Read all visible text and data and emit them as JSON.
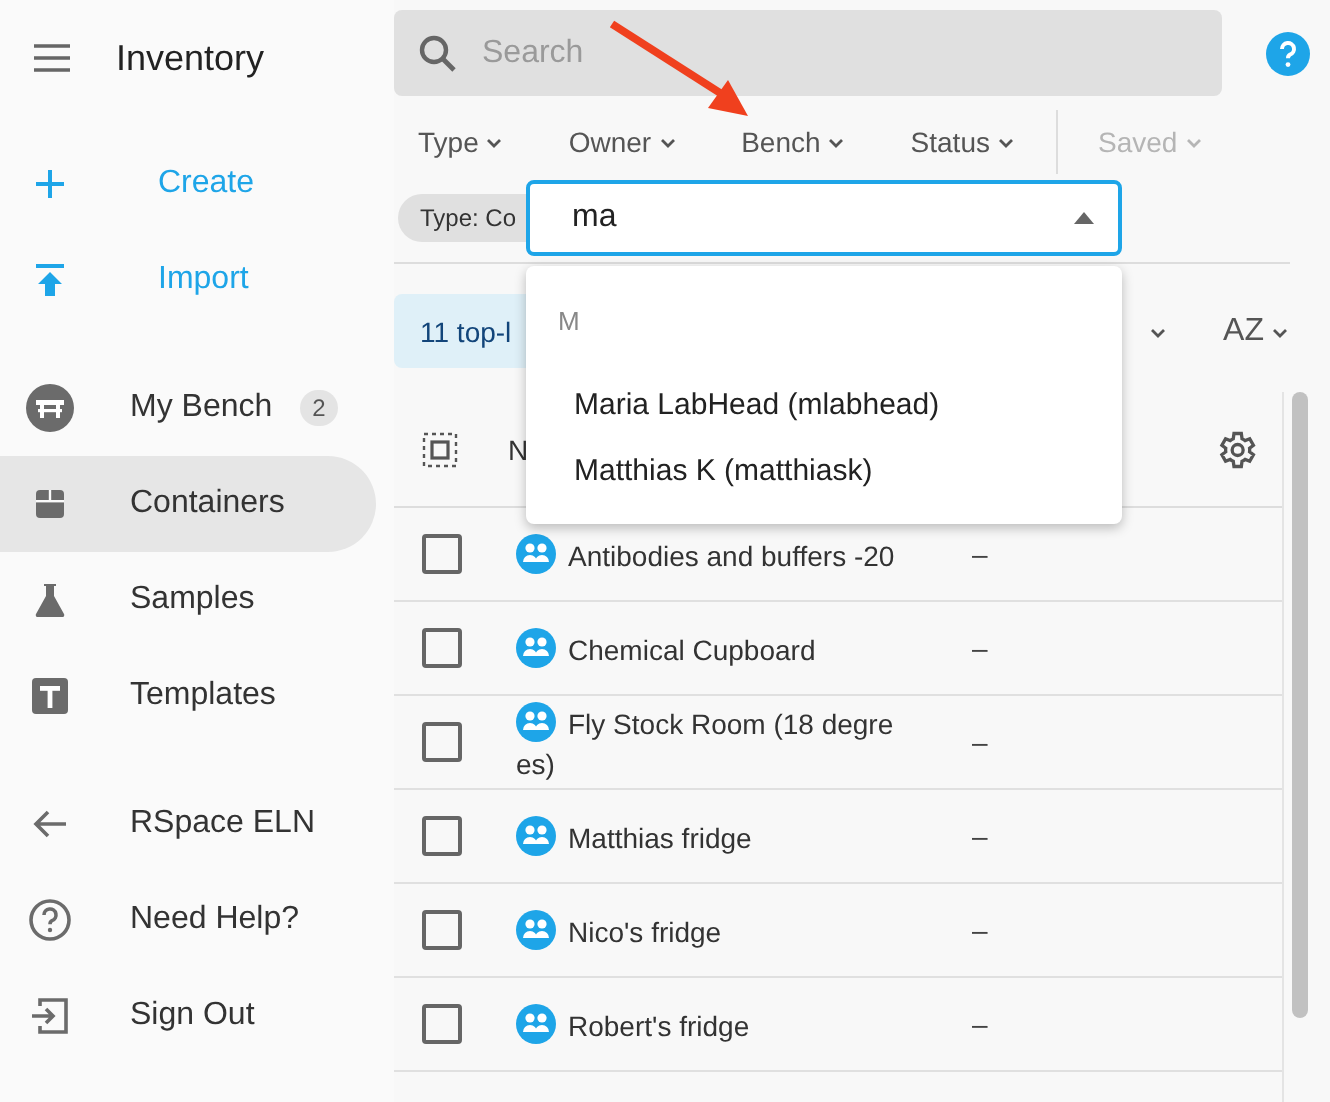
{
  "app_title": "Inventory",
  "sidebar": {
    "actions": [
      {
        "label": "Create"
      },
      {
        "label": "Import"
      }
    ],
    "nav": [
      {
        "label": "My Bench",
        "badge": "2",
        "selected": false
      },
      {
        "label": "Containers",
        "selected": true
      },
      {
        "label": "Samples",
        "selected": false
      },
      {
        "label": "Templates",
        "selected": false
      }
    ],
    "links": [
      {
        "label": "RSpace ELN"
      },
      {
        "label": "Need Help?"
      },
      {
        "label": "Sign Out"
      }
    ]
  },
  "search": {
    "placeholder": "Search"
  },
  "filters": [
    {
      "label": "Type",
      "disabled": false
    },
    {
      "label": "Owner",
      "disabled": false
    },
    {
      "label": "Bench",
      "disabled": false
    },
    {
      "label": "Status",
      "disabled": false
    },
    {
      "label": "Saved",
      "disabled": true
    }
  ],
  "chips": [
    {
      "label": "Type: Co"
    }
  ],
  "autocomplete": {
    "value": "ma",
    "group": "M",
    "options": [
      {
        "label": "Maria LabHead (mlabhead)"
      },
      {
        "label": "Matthias K (matthiask)"
      }
    ]
  },
  "results": {
    "summary": "11 top-l",
    "sort": "AZ"
  },
  "table": {
    "header": "N",
    "rows": [
      {
        "name": "Antibodies and buffers -20",
        "column_2": "–",
        "checked": false
      },
      {
        "name": "Chemical Cupboard",
        "column_2": "–",
        "checked": false
      },
      {
        "name": "Fly Stock Room (18 degrees)",
        "column_2": "–",
        "checked": false
      },
      {
        "name": "Matthias fridge",
        "column_2": "–",
        "checked": false
      },
      {
        "name": "Nico's fridge",
        "column_2": "–",
        "checked": false
      },
      {
        "name": "Robert's fridge",
        "column_2": "–",
        "checked": false
      }
    ]
  }
}
